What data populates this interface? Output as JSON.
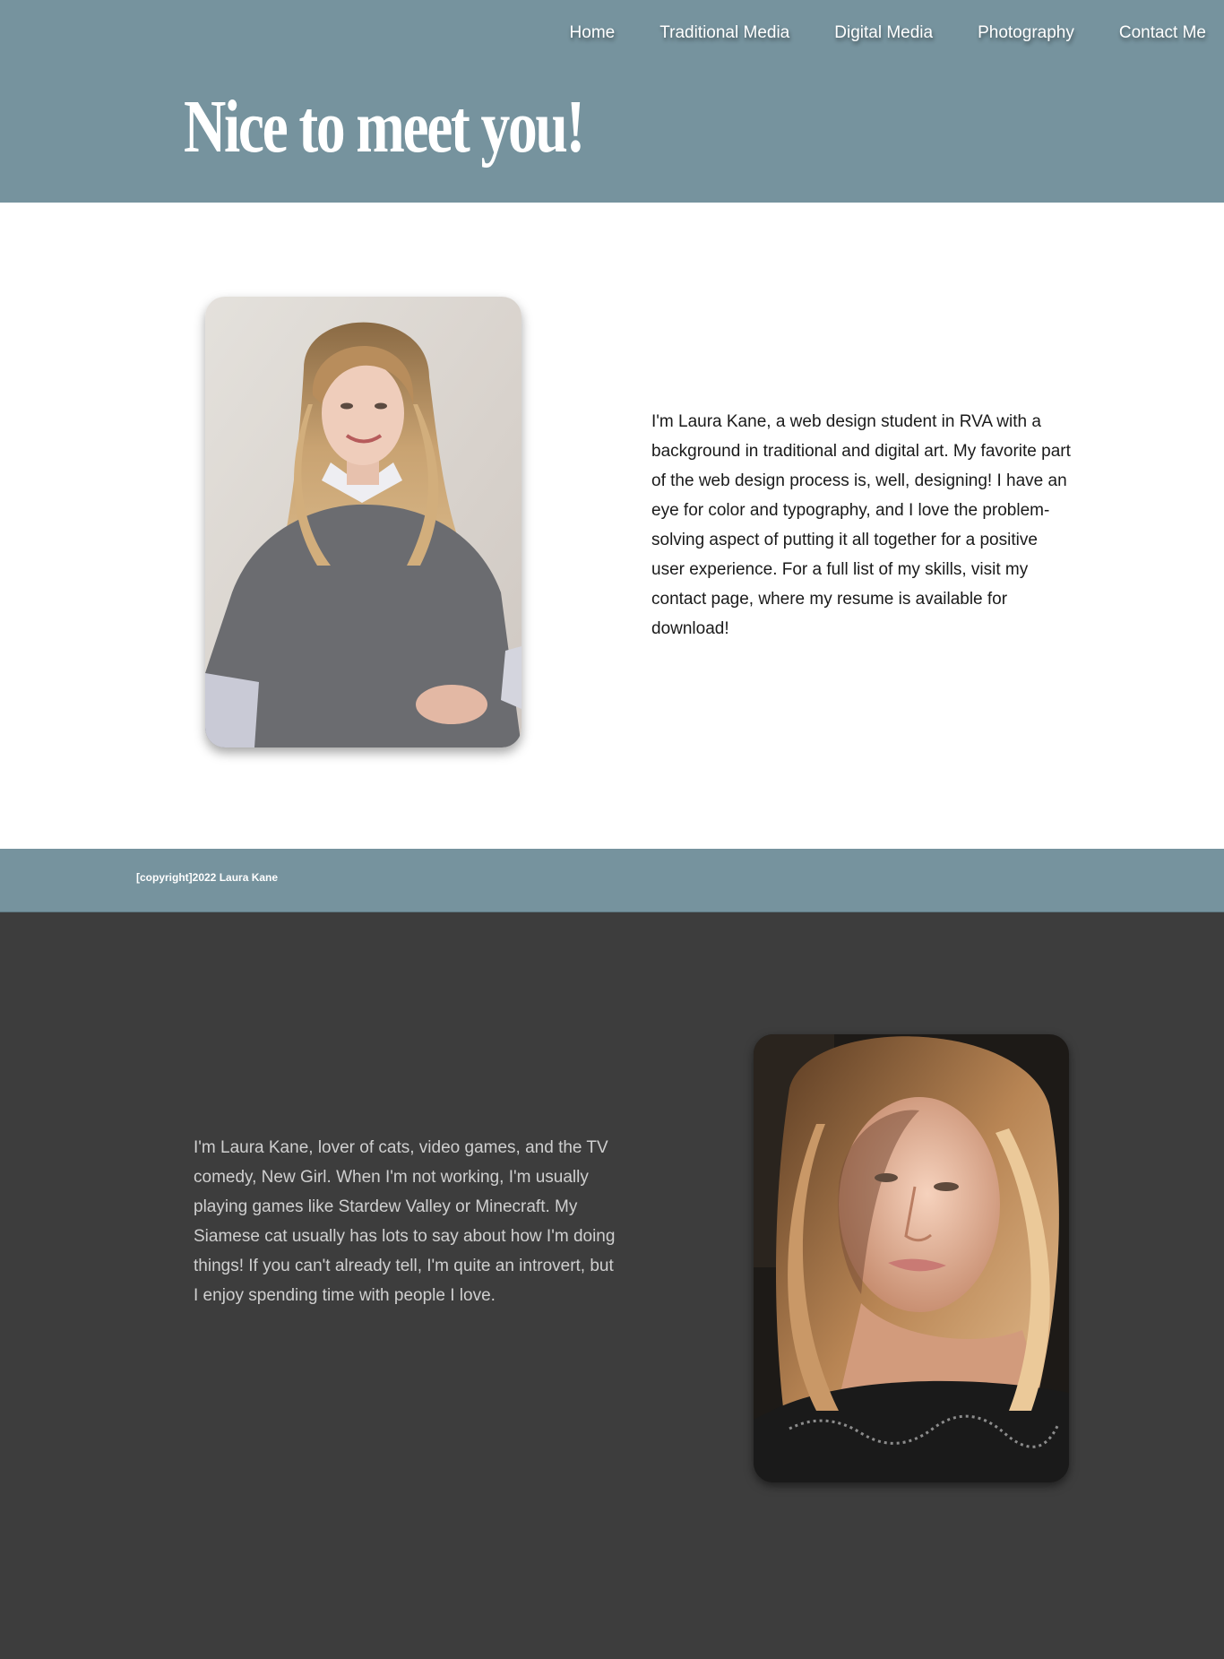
{
  "nav": {
    "items": [
      {
        "label": "Home"
      },
      {
        "label": "Traditional Media"
      },
      {
        "label": "Digital Media"
      },
      {
        "label": "Photography"
      },
      {
        "label": "Contact Me"
      }
    ]
  },
  "hero": {
    "title": "Nice to meet you!"
  },
  "about": {
    "bio": "I'm Laura Kane, a web design student in RVA with a background in traditional and digital art. My favorite part of the web design process is, well, designing! I have an eye for color and typography, and I love the problem-solving aspect of putting it all together for a positive user experience. For a full list of my skills, visit my contact page, where my resume is available for download!"
  },
  "footer": {
    "copyright": "[copyright]2022 Laura Kane"
  },
  "personal": {
    "bio": "I'm Laura Kane, lover of cats, video games, and the TV comedy, New Girl. When I'm not working, I'm usually playing games like Stardew Valley or Minecraft. My Siamese cat usually has lots to say about how I'm doing things! If you can't already tell, I'm quite an introvert, but I enjoy spending time with people I love."
  },
  "colors": {
    "header_bg": "#76939e",
    "dark_bg": "#3d3d3d",
    "light_bg": "#ffffff"
  }
}
